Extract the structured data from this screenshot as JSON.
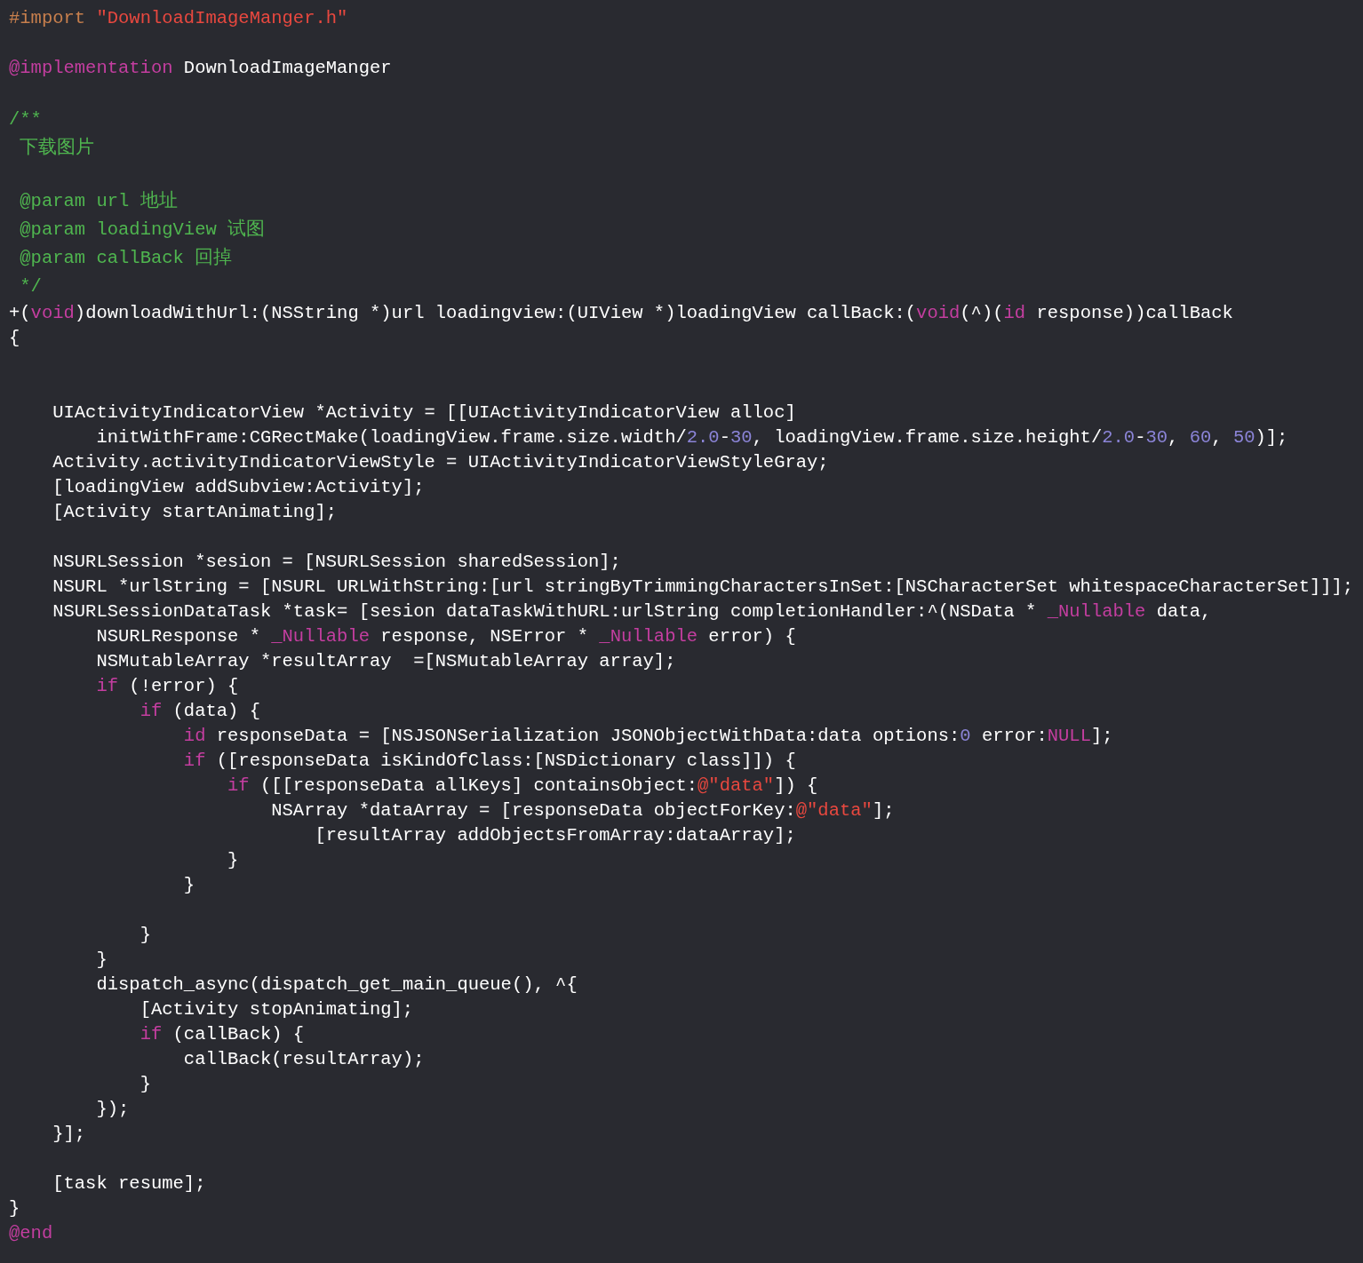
{
  "editor": {
    "lines": [
      {
        "kind": "code",
        "tokens": [
          {
            "kind": "preprocessor",
            "text": "#import "
          },
          {
            "kind": "string",
            "text": "\"DownloadImageManger.h\""
          }
        ]
      },
      {
        "kind": "blank"
      },
      {
        "kind": "code",
        "tokens": [
          {
            "kind": "keyword",
            "text": "@implementation"
          },
          {
            "kind": "plain",
            "text": " DownloadImageManger"
          }
        ]
      },
      {
        "kind": "blank"
      },
      {
        "kind": "code",
        "tokens": [
          {
            "kind": "comment",
            "text": "/**"
          }
        ]
      },
      {
        "kind": "code",
        "tokens": [
          {
            "kind": "comment",
            "text": " 下载图片"
          }
        ]
      },
      {
        "kind": "blank"
      },
      {
        "kind": "code",
        "tokens": [
          {
            "kind": "comment",
            "text": " @param url 地址"
          }
        ]
      },
      {
        "kind": "code",
        "tokens": [
          {
            "kind": "comment",
            "text": " @param loadingView 试图"
          }
        ]
      },
      {
        "kind": "code",
        "tokens": [
          {
            "kind": "comment",
            "text": " @param callBack 回掉"
          }
        ]
      },
      {
        "kind": "code",
        "tokens": [
          {
            "kind": "comment",
            "text": " */"
          }
        ]
      },
      {
        "kind": "code",
        "tokens": [
          {
            "kind": "plain",
            "text": "+("
          },
          {
            "kind": "keyword",
            "text": "void"
          },
          {
            "kind": "plain",
            "text": ")downloadWithUrl:(NSString *)url loadingview:(UIView *)loadingView callBack:("
          },
          {
            "kind": "keyword",
            "text": "void"
          },
          {
            "kind": "plain",
            "text": "(^)("
          },
          {
            "kind": "keyword",
            "text": "id"
          },
          {
            "kind": "plain",
            "text": " response))callBack"
          }
        ]
      },
      {
        "kind": "code",
        "tokens": [
          {
            "kind": "plain",
            "text": "{"
          }
        ]
      },
      {
        "kind": "blank"
      },
      {
        "kind": "blank"
      },
      {
        "kind": "code",
        "tokens": [
          {
            "kind": "plain",
            "text": "    UIActivityIndicatorView *Activity = [[UIActivityIndicatorView alloc]"
          }
        ]
      },
      {
        "kind": "code",
        "tokens": [
          {
            "kind": "plain",
            "text": "        initWithFrame:CGRectMake(loadingView.frame.size.width/"
          },
          {
            "kind": "number",
            "text": "2.0"
          },
          {
            "kind": "plain",
            "text": "-"
          },
          {
            "kind": "number",
            "text": "30"
          },
          {
            "kind": "plain",
            "text": ", loadingView.frame.size.height/"
          },
          {
            "kind": "number",
            "text": "2.0"
          },
          {
            "kind": "plain",
            "text": "-"
          },
          {
            "kind": "number",
            "text": "30"
          },
          {
            "kind": "plain",
            "text": ", "
          },
          {
            "kind": "number",
            "text": "60"
          },
          {
            "kind": "plain",
            "text": ", "
          },
          {
            "kind": "number",
            "text": "50"
          },
          {
            "kind": "plain",
            "text": ")];"
          }
        ]
      },
      {
        "kind": "code",
        "tokens": [
          {
            "kind": "plain",
            "text": "    Activity.activityIndicatorViewStyle = UIActivityIndicatorViewStyleGray;"
          }
        ]
      },
      {
        "kind": "code",
        "tokens": [
          {
            "kind": "plain",
            "text": "    [loadingView addSubview:Activity];"
          }
        ]
      },
      {
        "kind": "code",
        "tokens": [
          {
            "kind": "plain",
            "text": "    [Activity startAnimating];"
          }
        ]
      },
      {
        "kind": "blank"
      },
      {
        "kind": "code",
        "tokens": [
          {
            "kind": "plain",
            "text": "    NSURLSession *sesion = [NSURLSession sharedSession];"
          }
        ]
      },
      {
        "kind": "code",
        "tokens": [
          {
            "kind": "plain",
            "text": "    NSURL *urlString = [NSURL URLWithString:[url stringByTrimmingCharactersInSet:[NSCharacterSet whitespaceCharacterSet]]];"
          }
        ]
      },
      {
        "kind": "code",
        "tokens": [
          {
            "kind": "plain",
            "text": "    NSURLSessionDataTask *task= [sesion dataTaskWithURL:urlString completionHandler:^(NSData * "
          },
          {
            "kind": "keyword",
            "text": "_Nullable"
          },
          {
            "kind": "plain",
            "text": " data,"
          }
        ]
      },
      {
        "kind": "code",
        "tokens": [
          {
            "kind": "plain",
            "text": "        NSURLResponse * "
          },
          {
            "kind": "keyword",
            "text": "_Nullable"
          },
          {
            "kind": "plain",
            "text": " response, NSError * "
          },
          {
            "kind": "keyword",
            "text": "_Nullable"
          },
          {
            "kind": "plain",
            "text": " error) {"
          }
        ]
      },
      {
        "kind": "code",
        "tokens": [
          {
            "kind": "plain",
            "text": "        NSMutableArray *resultArray  =[NSMutableArray array];"
          }
        ]
      },
      {
        "kind": "code",
        "tokens": [
          {
            "kind": "keyword",
            "text": "        if"
          },
          {
            "kind": "plain",
            "text": " (!error) {"
          }
        ]
      },
      {
        "kind": "code",
        "tokens": [
          {
            "kind": "keyword",
            "text": "            if"
          },
          {
            "kind": "plain",
            "text": " (data) {"
          }
        ]
      },
      {
        "kind": "code",
        "tokens": [
          {
            "kind": "keyword",
            "text": "                id"
          },
          {
            "kind": "plain",
            "text": " responseData = [NSJSONSerialization JSONObjectWithData:data options:"
          },
          {
            "kind": "number",
            "text": "0"
          },
          {
            "kind": "plain",
            "text": " error:"
          },
          {
            "kind": "keyword",
            "text": "NULL"
          },
          {
            "kind": "plain",
            "text": "];"
          }
        ]
      },
      {
        "kind": "code",
        "tokens": [
          {
            "kind": "keyword",
            "text": "                if"
          },
          {
            "kind": "plain",
            "text": " ([responseData isKindOfClass:[NSDictionary class]]) {"
          }
        ]
      },
      {
        "kind": "code",
        "tokens": [
          {
            "kind": "keyword",
            "text": "                    if"
          },
          {
            "kind": "plain",
            "text": " ([[responseData allKeys] containsObject:"
          },
          {
            "kind": "string",
            "text": "@\"data\""
          },
          {
            "kind": "plain",
            "text": "]) {"
          }
        ]
      },
      {
        "kind": "code",
        "tokens": [
          {
            "kind": "plain",
            "text": "                        NSArray *dataArray = [responseData objectForKey:"
          },
          {
            "kind": "string",
            "text": "@\"data\""
          },
          {
            "kind": "plain",
            "text": "];"
          }
        ]
      },
      {
        "kind": "code",
        "tokens": [
          {
            "kind": "plain",
            "text": "                            [resultArray addObjectsFromArray:dataArray];"
          }
        ]
      },
      {
        "kind": "code",
        "tokens": [
          {
            "kind": "plain",
            "text": "                    }"
          }
        ]
      },
      {
        "kind": "code",
        "tokens": [
          {
            "kind": "plain",
            "text": "                }"
          }
        ]
      },
      {
        "kind": "blank"
      },
      {
        "kind": "code",
        "tokens": [
          {
            "kind": "plain",
            "text": "            }"
          }
        ]
      },
      {
        "kind": "code",
        "tokens": [
          {
            "kind": "plain",
            "text": "        }"
          }
        ]
      },
      {
        "kind": "code",
        "tokens": [
          {
            "kind": "plain",
            "text": "        dispatch_async(dispatch_get_main_queue(), ^{"
          }
        ]
      },
      {
        "kind": "code",
        "tokens": [
          {
            "kind": "plain",
            "text": "            [Activity stopAnimating];"
          }
        ]
      },
      {
        "kind": "code",
        "tokens": [
          {
            "kind": "keyword",
            "text": "            if"
          },
          {
            "kind": "plain",
            "text": " (callBack) {"
          }
        ]
      },
      {
        "kind": "code",
        "tokens": [
          {
            "kind": "plain",
            "text": "                callBack(resultArray);"
          }
        ]
      },
      {
        "kind": "code",
        "tokens": [
          {
            "kind": "plain",
            "text": "            }"
          }
        ]
      },
      {
        "kind": "code",
        "tokens": [
          {
            "kind": "plain",
            "text": "        });"
          }
        ]
      },
      {
        "kind": "code",
        "tokens": [
          {
            "kind": "plain",
            "text": "    }];"
          }
        ]
      },
      {
        "kind": "blank"
      },
      {
        "kind": "code",
        "tokens": [
          {
            "kind": "plain",
            "text": "    [task resume];"
          }
        ]
      },
      {
        "kind": "code",
        "tokens": [
          {
            "kind": "plain",
            "text": "}"
          }
        ]
      },
      {
        "kind": "code",
        "tokens": [
          {
            "kind": "keyword",
            "text": "@end"
          }
        ]
      }
    ]
  }
}
